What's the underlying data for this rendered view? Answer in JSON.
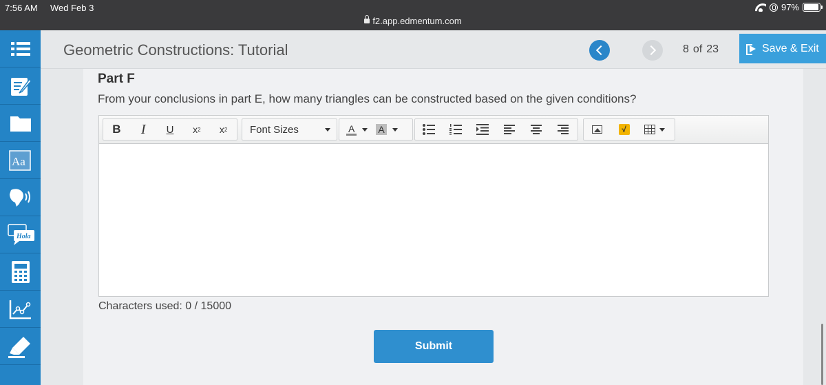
{
  "status_bar": {
    "time": "7:56 AM",
    "date": "Wed Feb 3",
    "url": "f2.app.edmentum.com",
    "battery": "97%",
    "battery_level": 0.97
  },
  "tool_rail": {
    "items": [
      "list-icon",
      "notepad-icon",
      "folder-icon",
      "dictionary-icon",
      "text-to-speech-icon",
      "translation-icon",
      "calculator-icon",
      "graph-icon",
      "highlighter-icon"
    ],
    "translation_label": "Hola",
    "dictionary_label": "Aa"
  },
  "header": {
    "title": "Geometric Constructions: Tutorial",
    "page_current": "8",
    "page_of": "of",
    "page_total": "23",
    "save_exit_label": "Save & Exit"
  },
  "main": {
    "part_title": "Part F",
    "question": "From your conclusions in part E, how many triangles can be constructed based on the given conditions?",
    "toolbar": {
      "bold": "B",
      "italic": "I",
      "underline": "U",
      "superscript_base": "x",
      "superscript_exp": "2",
      "subscript_base": "x",
      "subscript_sub": "2",
      "font_sizes": "Font Sizes",
      "text_color": "A",
      "bg_color": "A"
    },
    "answer_text": "",
    "characters_used": "Characters used: 0 / 15000",
    "submit_label": "Submit"
  },
  "colors": {
    "rail_blue": "#2484c6",
    "accent_blue": "#2f8fcf",
    "save_button": "#3aa0dc"
  }
}
